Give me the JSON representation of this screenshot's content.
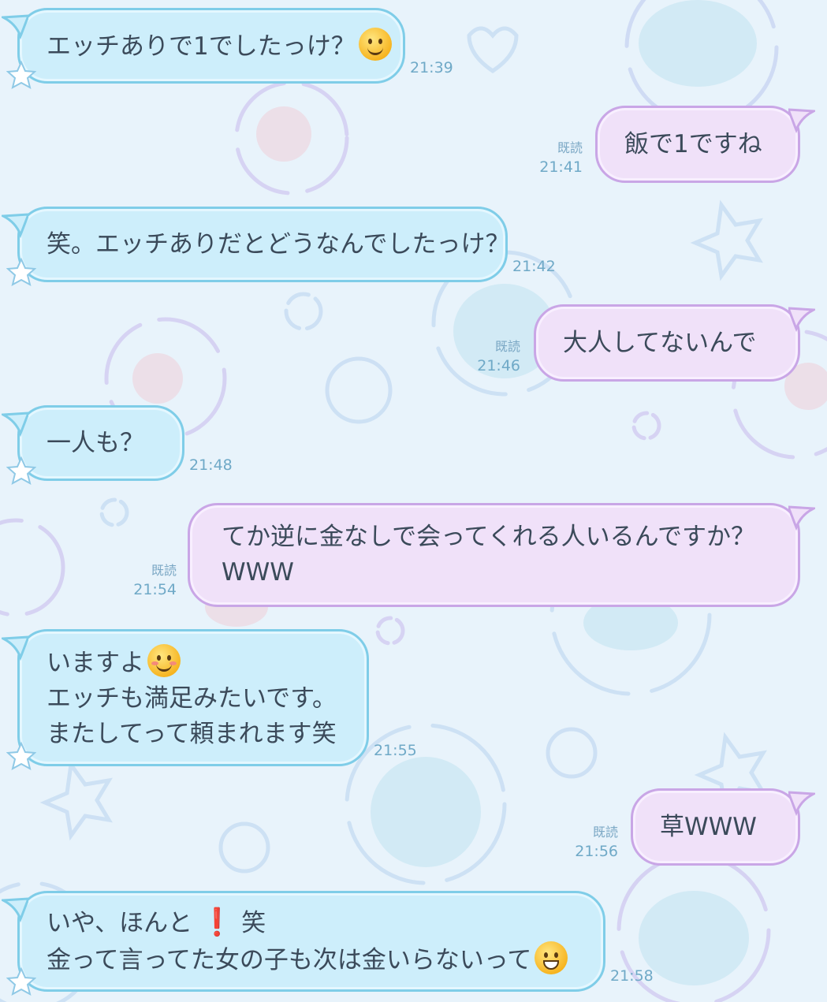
{
  "colors": {
    "incoming_bubble": "#cdeefb",
    "incoming_border": "#7fcde8",
    "outgoing_bubble": "#f0e1f9",
    "outgoing_border": "#c9a6e6",
    "background": "#e8f3fb"
  },
  "read_label": "既読",
  "messages": [
    {
      "id": "m1",
      "side": "in",
      "lines": [
        "エッチありで1でしたっけ？"
      ],
      "emoji": "thinking-face",
      "time": "21:39"
    },
    {
      "id": "m2",
      "side": "out",
      "lines": [
        "飯で1ですね"
      ],
      "time": "21:41",
      "read": "既読"
    },
    {
      "id": "m3",
      "side": "in",
      "lines": [
        "笑。エッチありだとどうなんでしたっけ？"
      ],
      "time": "21:42"
    },
    {
      "id": "m4",
      "side": "out",
      "lines": [
        "大人してないんで"
      ],
      "time": "21:46",
      "read": "既読"
    },
    {
      "id": "m5",
      "side": "in",
      "lines": [
        "一人も？"
      ],
      "time": "21:48"
    },
    {
      "id": "m6",
      "side": "out",
      "lines": [
        "てか逆に金なしで会ってくれる人いるんですか？",
        "WWW"
      ],
      "time": "21:54",
      "read": "既読"
    },
    {
      "id": "m7",
      "side": "in",
      "lines": [
        "いますよ",
        "エッチも満足みたいです。",
        "またしてって頼まれます笑"
      ],
      "emoji": "smiling-face",
      "time": "21:55"
    },
    {
      "id": "m8",
      "side": "out",
      "lines": [
        "草WWW"
      ],
      "time": "21:56",
      "read": "既読"
    },
    {
      "id": "m9",
      "side": "in",
      "lines": [
        "いや、ほんと",
        "金って言ってた女の子も次は金いらないって"
      ],
      "line1_suffix": "笑",
      "emoji": "grinning-face",
      "exclamation": "❗",
      "time": "21:58"
    }
  ]
}
